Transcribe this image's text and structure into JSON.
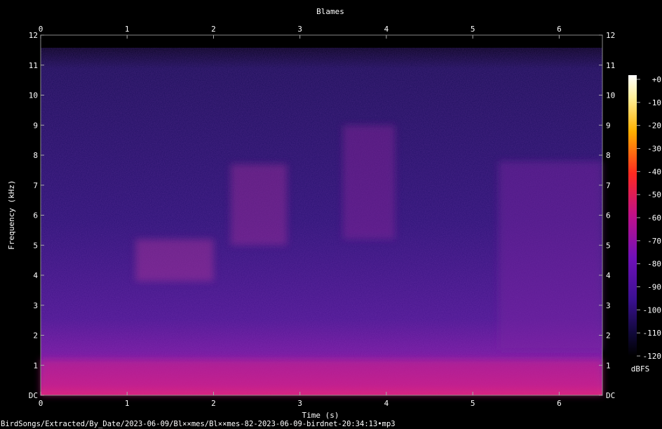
{
  "chart_data": {
    "type": "heatmap",
    "title": "Blames",
    "xlabel": "Time (s)",
    "ylabel": "Frequency (kHz)",
    "xlim": [
      0,
      6.5
    ],
    "ylim": [
      0,
      12
    ],
    "x_ticks": [
      "0",
      "1",
      "2",
      "3",
      "4",
      "5",
      "6"
    ],
    "y_ticks": [
      "DC",
      "1",
      "2",
      "3",
      "4",
      "5",
      "6",
      "7",
      "8",
      "9",
      "10",
      "11",
      "12"
    ],
    "colorbar": {
      "label": "dBFS",
      "range": [
        -120,
        0
      ],
      "ticks": [
        "+0",
        "-10",
        "-20",
        "-30",
        "-40",
        "-50",
        "-60",
        "-70",
        "-80",
        "-90",
        "-100",
        "-110",
        "-120"
      ]
    },
    "bright_regions": [
      {
        "x": [
          1.1,
          2.0
        ],
        "y": [
          3.8,
          5.2
        ]
      },
      {
        "x": [
          2.2,
          2.85
        ],
        "y": [
          5.0,
          7.7
        ]
      },
      {
        "x": [
          3.5,
          4.1
        ],
        "y": [
          5.2,
          9.0
        ]
      },
      {
        "x": [
          5.3,
          6.5
        ],
        "y": [
          1.5,
          7.8
        ]
      },
      {
        "x": [
          0,
          6.5
        ],
        "y": [
          0,
          1.2
        ]
      }
    ]
  },
  "footer": {
    "filepath": "BirdSongs/Extracted/By_Date/2023-06-09/Bl××mes/Bl××mes-82-2023-06-09-birdnet-20:34:13•mp3"
  }
}
